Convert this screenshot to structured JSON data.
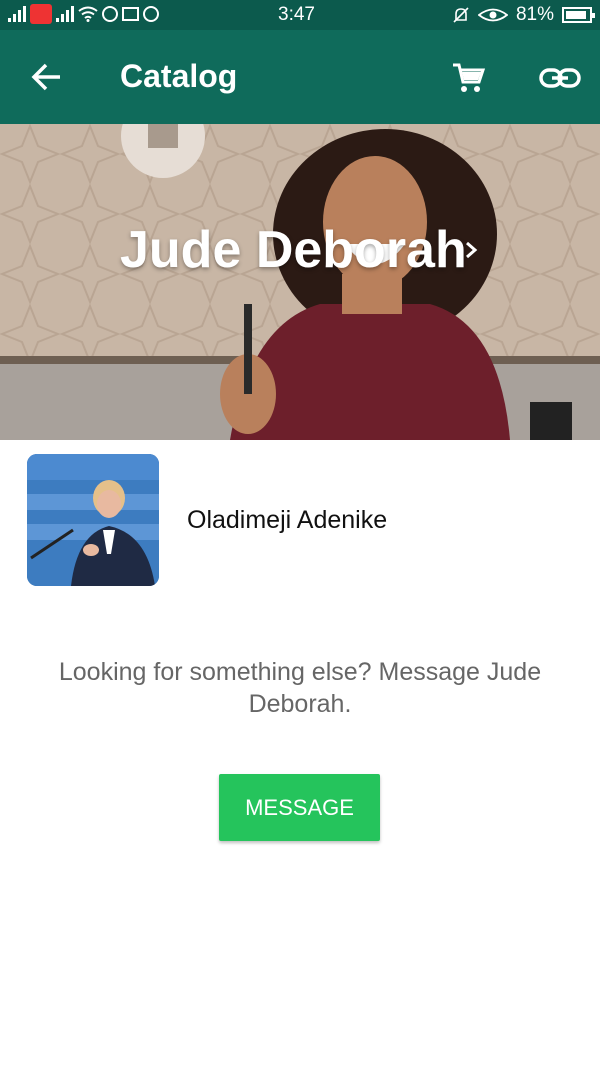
{
  "status_bar": {
    "time": "3:47",
    "battery": "81%"
  },
  "app_bar": {
    "title": "Catalog",
    "icons": [
      "back-arrow-icon",
      "cart-icon",
      "link-icon"
    ]
  },
  "cover": {
    "business_name": "Jude Deborah"
  },
  "product": {
    "name": "Oladimeji Adenike"
  },
  "message_prompt": "Looking for something else? Message Jude Deborah.",
  "message_button": "MESSAGE",
  "colors": {
    "status_bar": "#0c5a4d",
    "app_bar": "#0f6b5b",
    "button": "#25c45c",
    "prompt_text": "#666666"
  }
}
